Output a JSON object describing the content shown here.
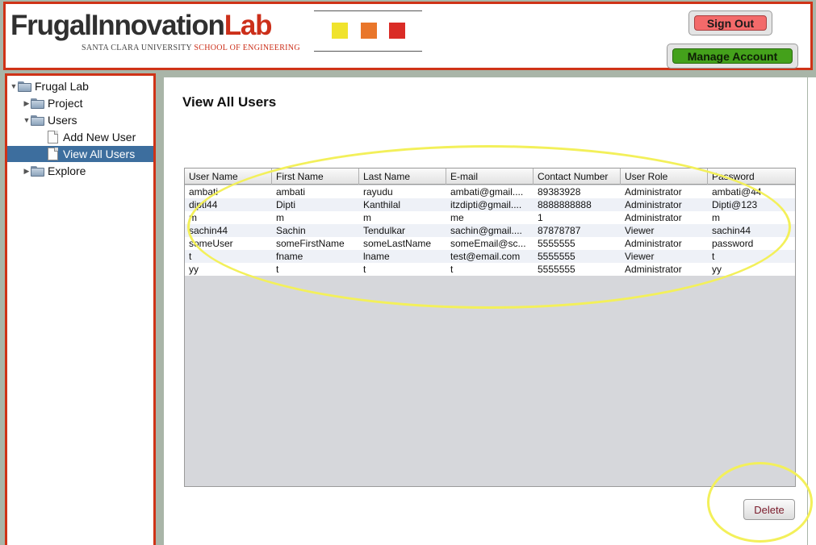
{
  "header": {
    "logo_part1": "FrugalInnovation",
    "logo_part2": "Lab",
    "logo_sub_university": "SANTA CLARA UNIVERSITY",
    "logo_sub_school": "SCHOOL OF ENGINEERING",
    "signout_label": "Sign Out",
    "manage_label": "Manage Account"
  },
  "tree": {
    "root": "Frugal Lab",
    "project": "Project",
    "users": "Users",
    "add_user": "Add New User",
    "view_users": "View All Users",
    "explore": "Explore"
  },
  "main": {
    "title": "View All Users",
    "delete_label": "Delete"
  },
  "table": {
    "columns": [
      "User Name",
      "First Name",
      "Last Name",
      "E-mail",
      "Contact Number",
      "User Role",
      "Password"
    ],
    "rows": [
      [
        "ambati",
        "ambati",
        "rayudu",
        "ambati@gmail....",
        "89383928",
        "Administrator",
        "ambati@44"
      ],
      [
        "dipti44",
        "Dipti",
        "Kanthilal",
        "itzdipti@gmail....",
        "8888888888",
        "Administrator",
        "Dipti@123"
      ],
      [
        "m",
        "m",
        "m",
        "me",
        "1",
        "Administrator",
        "m"
      ],
      [
        "sachin44",
        "Sachin",
        "Tendulkar",
        "sachin@gmail....",
        "87878787",
        "Viewer",
        "sachin44"
      ],
      [
        "someUser",
        "someFirstName",
        "someLastName",
        "someEmail@sc...",
        "5555555",
        "Administrator",
        "password"
      ],
      [
        "t",
        "fname",
        "lname",
        "test@email.com",
        "5555555",
        "Viewer",
        "t"
      ],
      [
        "yy",
        "t",
        "t",
        "t",
        "5555555",
        "Administrator",
        "yy"
      ]
    ]
  },
  "colors": {
    "frame_red": "#cf3317",
    "selected_blue": "#3d6e9e",
    "highlight_yellow": "#f3f05a",
    "signout_red": "#f36a6a",
    "manage_green": "#44a11b"
  }
}
